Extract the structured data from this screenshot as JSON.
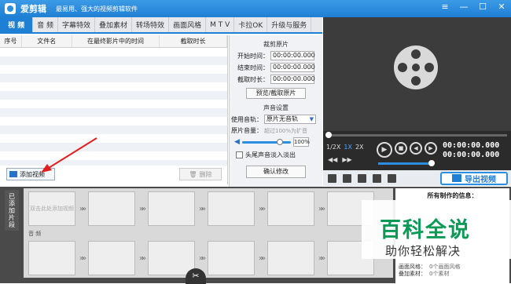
{
  "app": {
    "title": "爱剪辑",
    "slogan": "最易用、强大的视频剪辑软件"
  },
  "tabs": [
    {
      "label": "视 频"
    },
    {
      "label": "音 频"
    },
    {
      "label": "字幕特效"
    },
    {
      "label": "叠加素材"
    },
    {
      "label": "转场特效"
    },
    {
      "label": "画面风格"
    },
    {
      "label": "M T V"
    },
    {
      "label": "卡拉OK"
    },
    {
      "label": "升级与服务"
    }
  ],
  "list": {
    "columns": [
      "序号",
      "文件名",
      "在最终影片中的时间",
      "截取时长"
    ],
    "add_label": "添加视频",
    "delete_label": "删除"
  },
  "edit": {
    "clip_section": "裁剪原片",
    "start_label": "开始时间：",
    "start_value": "00:00:00.000",
    "end_label": "结束时间：",
    "end_value": "00:00:00.000",
    "dur_label": "截取时长：",
    "dur_value": "00:00:00.000",
    "preview_btn": "预览/截取原片",
    "sound_section": "声音设置",
    "track_label": "使用音轨：",
    "track_value": "原片无音轨",
    "volume_label": "原片音量：",
    "volume_hint": "超过100%为扩音",
    "volume_pct": "100%",
    "fade_label": "头尾声音淡入淡出",
    "confirm_btn": "确认修改"
  },
  "player": {
    "speeds": [
      "1/2X",
      "1X",
      "2X"
    ],
    "time_current": "00:00:00.000",
    "time_total": "00:00:00.000",
    "progress": 0,
    "volume_level": 0.85,
    "export_label": "导出视频"
  },
  "timeline": {
    "side_label": "已添加片段",
    "first_clip_text": "双击此处添加视频",
    "audio_label": "音 频"
  },
  "info": {
    "title": "所有制作的信息：",
    "lines": [
      {
        "key": "画面风格：",
        "value": "0个画面风格"
      },
      {
        "key": "叠加素材：",
        "value": "0个素材"
      }
    ]
  },
  "watermark": {
    "title": "百科全说",
    "subtitle": "助你轻松解决"
  },
  "colors": {
    "accent": "#1f7fd4",
    "watermark": "#0a9a55"
  }
}
